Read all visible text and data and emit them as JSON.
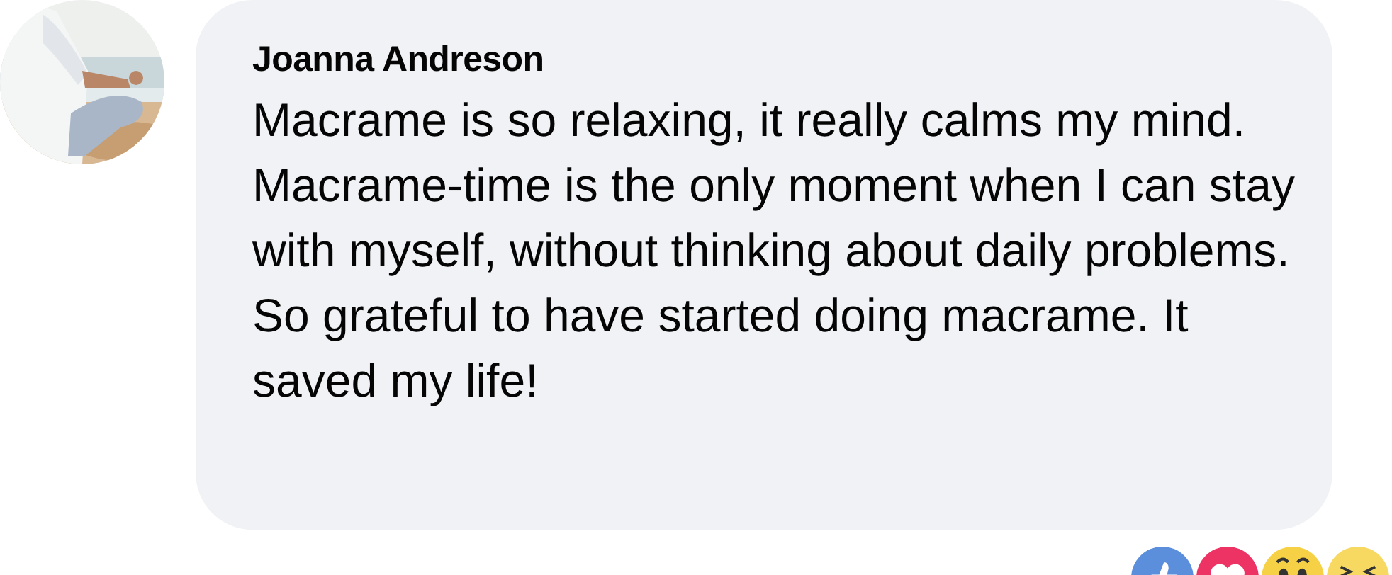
{
  "comment": {
    "author": "Joanna Andreson",
    "text": "Macrame is so relaxing, it really calms my mind. Macrame-time is the only moment when I can stay with myself, without thinking about daily problems. So grateful to have started doing macrame. It saved my life!",
    "reactions": [
      {
        "kind": "like"
      },
      {
        "kind": "love"
      },
      {
        "kind": "wow"
      },
      {
        "kind": "haha"
      }
    ]
  }
}
